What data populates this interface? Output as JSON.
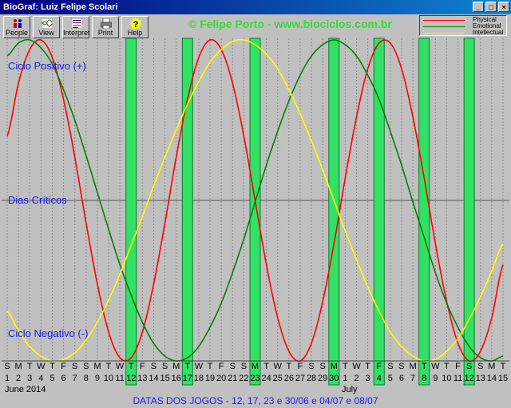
{
  "window": {
    "title": "BioGraf: Luiz Felipe Scolari",
    "controls": [
      "_",
      "□",
      "×"
    ]
  },
  "toolbar": [
    {
      "label": "People",
      "icon": "people-icon"
    },
    {
      "label": "View",
      "icon": "view-icon"
    },
    {
      "label": "Interpret",
      "icon": "interpret-icon"
    },
    {
      "label": "Print",
      "icon": "print-icon"
    },
    {
      "label": "Help",
      "icon": "help-icon"
    }
  ],
  "credit": "© Felipe Porto - www.biociclos.com.br",
  "legend": [
    {
      "name": "Physical",
      "color": "#ff0000"
    },
    {
      "name": "Emotional",
      "color": "#008000"
    },
    {
      "name": "Intellectual",
      "color": "#ffff00"
    }
  ],
  "labels": {
    "positive": "Ciclo Positivo (+)",
    "critical": "Dias Críticos",
    "negative": "Ciclo Negativo (-)"
  },
  "months": [
    "June 2014",
    "July"
  ],
  "footer": "DATAS DOS JOGOS - 12, 17, 23 e 30/06 e 04/07 e 08/07",
  "chart_data": {
    "type": "line",
    "x_letters": [
      "S",
      "M",
      "T",
      "W",
      "T",
      "F",
      "S",
      "S",
      "M",
      "T",
      "W",
      "T",
      "F",
      "S",
      "S",
      "M",
      "T",
      "W",
      "T",
      "F",
      "S",
      "S",
      "M",
      "T",
      "W",
      "T",
      "F",
      "S",
      "S",
      "M",
      "T",
      "W",
      "T",
      "F",
      "S",
      "S",
      "M",
      "T",
      "W",
      "T",
      "F",
      "S",
      "S",
      "M",
      "T"
    ],
    "x": [
      "1",
      "2",
      "3",
      "4",
      "5",
      "6",
      "7",
      "8",
      "9",
      "10",
      "11",
      "12",
      "13",
      "14",
      "15",
      "16",
      "17",
      "18",
      "19",
      "20",
      "21",
      "22",
      "23",
      "24",
      "25",
      "26",
      "27",
      "28",
      "29",
      "30",
      "1",
      "2",
      "3",
      "4",
      "5",
      "6",
      "7",
      "8",
      "9",
      "10",
      "11",
      "12",
      "13",
      "14",
      "15"
    ],
    "highlighted_days": [
      "12",
      "17",
      "23",
      "30",
      "4",
      "8"
    ],
    "ylim": [
      -1,
      1
    ],
    "series": [
      {
        "name": "Physical",
        "color": "#ff0000",
        "values": [
          0.4,
          0.73,
          0.94,
          1,
          0.89,
          0.63,
          0.27,
          -0.14,
          -0.52,
          -0.82,
          -0.98,
          -0.98,
          -0.82,
          -0.52,
          -0.14,
          0.27,
          0.63,
          0.89,
          1,
          0.94,
          0.73,
          0.4,
          0,
          -0.4,
          -0.73,
          -0.94,
          -1,
          -0.89,
          -0.63,
          -0.27,
          0.14,
          0.52,
          0.82,
          0.98,
          0.98,
          0.82,
          0.52,
          0.14,
          -0.27,
          -0.63,
          -0.89,
          -1,
          -0.94,
          -0.73,
          -0.4
        ]
      },
      {
        "name": "Emotional",
        "color": "#008000",
        "values": [
          0.9,
          0.98,
          1,
          0.95,
          0.85,
          0.69,
          0.5,
          0.28,
          0.05,
          -0.18,
          -0.4,
          -0.59,
          -0.76,
          -0.89,
          -0.97,
          -1,
          -0.98,
          -0.91,
          -0.79,
          -0.64,
          -0.45,
          -0.24,
          -0.01,
          0.22,
          0.43,
          0.62,
          0.78,
          0.9,
          0.97,
          1,
          0.97,
          0.9,
          0.78,
          0.63,
          0.43,
          0.22,
          -0.01,
          -0.23,
          -0.45,
          -0.64,
          -0.79,
          -0.91,
          -0.98,
          -1,
          -0.97
        ]
      },
      {
        "name": "Intellectual",
        "color": "#ffff00",
        "values": [
          -0.69,
          -0.81,
          -0.91,
          -0.97,
          -1,
          -0.99,
          -0.95,
          -0.87,
          -0.76,
          -0.62,
          -0.46,
          -0.28,
          -0.1,
          0.09,
          0.27,
          0.44,
          0.6,
          0.74,
          0.86,
          0.94,
          0.99,
          1,
          0.97,
          0.91,
          0.82,
          0.69,
          0.54,
          0.37,
          0.19,
          0,
          -0.19,
          -0.37,
          -0.54,
          -0.69,
          -0.82,
          -0.91,
          -0.97,
          -1,
          -0.99,
          -0.94,
          -0.86,
          -0.74,
          -0.6,
          -0.44,
          -0.27
        ]
      }
    ]
  }
}
